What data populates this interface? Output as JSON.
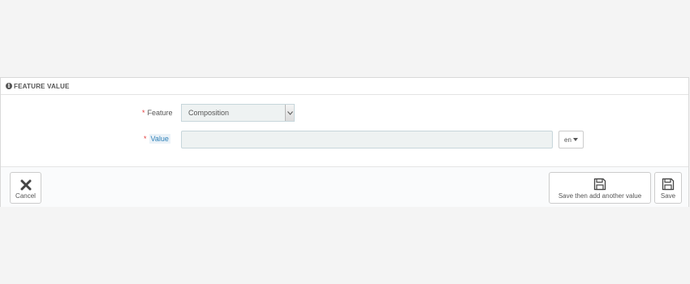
{
  "panel": {
    "heading_icon": "info-icon",
    "heading_title": "FEATURE VALUE"
  },
  "form": {
    "feature": {
      "required_mark": "*",
      "label": "Feature",
      "selected_value": "Composition"
    },
    "value": {
      "required_mark": "*",
      "label": "Value",
      "input_value": "",
      "language": "en"
    }
  },
  "footer": {
    "cancel_label": "Cancel",
    "cancel_icon": "close-icon",
    "save_and_add_label": "Save then add another value",
    "save_and_add_icon": "floppy-disk-icon",
    "save_label": "Save",
    "save_icon": "floppy-disk-icon"
  },
  "colors": {
    "required": "#e23b3b",
    "hint_text": "#2f81b8",
    "input_bg": "#eef2f2",
    "page_bg": "#f4f4f4"
  }
}
